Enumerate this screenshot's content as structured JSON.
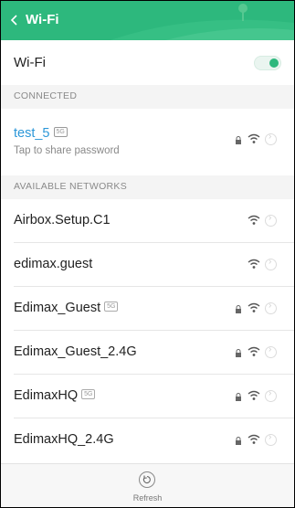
{
  "header": {
    "title": "Wi-Fi",
    "back_icon": "chevron-left-icon",
    "accent": "#2db87d"
  },
  "wifi": {
    "label": "Wi-Fi",
    "enabled": true
  },
  "sections": {
    "connected": "CONNECTED",
    "available": "AVAILABLE NETWORKS"
  },
  "connected_network": {
    "name": "test_5",
    "band": "5G",
    "subtitle": "Tap to share password"
  },
  "networks": [
    {
      "name": "Airbox.Setup.C1",
      "band": "",
      "secured": false
    },
    {
      "name": "edimax.guest",
      "band": "",
      "secured": false
    },
    {
      "name": "Edimax_Guest",
      "band": "5G",
      "secured": true
    },
    {
      "name": "Edimax_Guest_2.4G",
      "band": "",
      "secured": true
    },
    {
      "name": "EdimaxHQ",
      "band": "5G",
      "secured": true
    },
    {
      "name": "EdimaxHQ_2.4G",
      "band": "",
      "secured": true
    }
  ],
  "footer": {
    "refresh_label": "Refresh"
  }
}
